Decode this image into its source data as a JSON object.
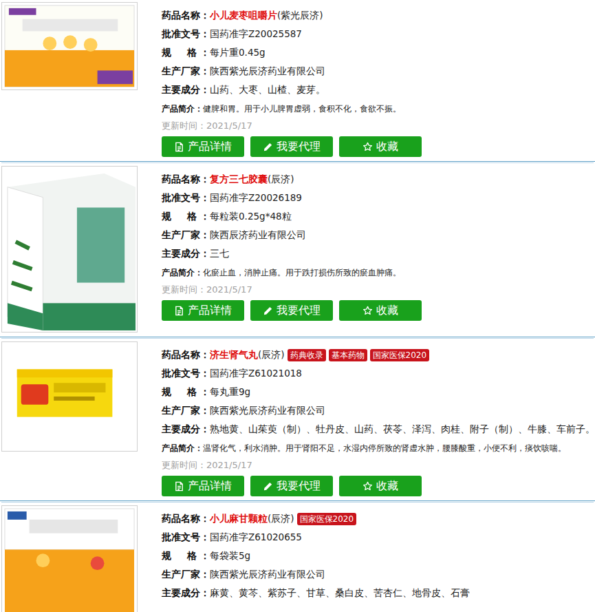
{
  "products": [
    {
      "name_label": "药品名称：",
      "name": "小儿麦枣咀嚼片",
      "name_suffix": "(紫光辰济)",
      "badges": [],
      "fields": [
        {
          "label": "批准文号：",
          "value": "国药准字Z20025587"
        },
        {
          "label": "规　格：",
          "value": "每片重0.45g"
        },
        {
          "label": "生产厂家：",
          "value": "陕西紫光辰济药业有限公司"
        },
        {
          "label": "主要成分：",
          "value": "山药、大枣、山楂、麦芽。"
        }
      ],
      "intro": {
        "label": "产品简介：",
        "value": "健脾和胃。用于小儿脾胃虚弱，食积不化，食欲不振。"
      },
      "updated": "更新时间：2021/5/17",
      "buttons": [
        {
          "label": "产品详情"
        },
        {
          "label": "我要代理"
        },
        {
          "label": "收藏"
        }
      ]
    },
    {
      "name_label": "药品名称：",
      "name": "复方三七胶囊",
      "name_suffix": "(辰济)",
      "badges": [],
      "fields": [
        {
          "label": "批准文号：",
          "value": "国药准字Z20026189"
        },
        {
          "label": "规　格：",
          "value": "每粒装0.25g*48粒"
        },
        {
          "label": "生产厂家：",
          "value": "陕西辰济药业有限公司"
        },
        {
          "label": "主要成分：",
          "value": "三七"
        }
      ],
      "intro": {
        "label": "产品简介：",
        "value": "化瘀止血，消肿止痛。用于跌打损伤所致的瘀血肿痛。"
      },
      "updated": "更新时间：2021/5/17",
      "buttons": [
        {
          "label": "产品详情"
        },
        {
          "label": "我要代理"
        },
        {
          "label": "收藏"
        }
      ]
    },
    {
      "name_label": "药品名称：",
      "name": "济生肾气丸",
      "name_suffix": "(辰济)",
      "badges": [
        "药典收录",
        "基本药物",
        "国家医保2020"
      ],
      "fields": [
        {
          "label": "批准文号：",
          "value": "国药准字Z61021018"
        },
        {
          "label": "规　格：",
          "value": "每丸重9g"
        },
        {
          "label": "生产厂家：",
          "value": "陕西紫光辰济药业有限公司"
        },
        {
          "label": "主要成分：",
          "value": "熟地黄、山茱萸（制）、牡丹皮、山药、茯苓、泽泻、肉桂、附子（制）、牛膝、车前子。"
        }
      ],
      "intro": {
        "label": "产品简介：",
        "value": "温肾化气，利水消肿。用于肾阳不足，水湿内停所致的肾虚水肿，腰膝酸重，小便不利，痰饮咳喘。"
      },
      "updated": "更新时间：2021/5/17",
      "buttons": [
        {
          "label": "产品详情"
        },
        {
          "label": "我要代理"
        },
        {
          "label": "收藏"
        }
      ]
    },
    {
      "name_label": "药品名称：",
      "name": "小儿麻甘颗粒",
      "name_suffix": "(辰济)",
      "badges": [
        "国家医保2020"
      ],
      "fields": [
        {
          "label": "批准文号：",
          "value": "国药准字Z61020655"
        },
        {
          "label": "规　格：",
          "value": "每袋装5g"
        },
        {
          "label": "生产厂家：",
          "value": "陕西紫光辰济药业有限公司"
        },
        {
          "label": "主要成分：",
          "value": "麻黄、黄芩、紫苏子、甘草、桑白皮、苦杏仁、地骨皮、石膏"
        }
      ],
      "buttons": []
    }
  ]
}
